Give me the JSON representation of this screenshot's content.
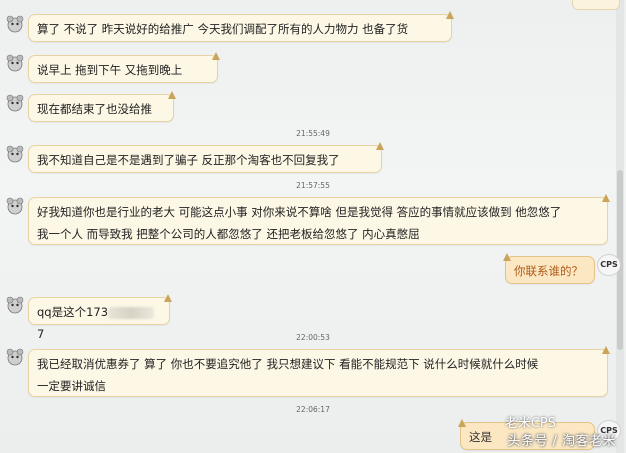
{
  "messages": [
    {
      "text": "算了 不说了  昨天说好的给推广  今天我们调配了所有的人力物力  也备了货"
    },
    {
      "text": "说早上  拖到下午    又拖到晚上"
    },
    {
      "text": "现在都结束了也没给推"
    },
    {
      "time": "21:55:49"
    },
    {
      "text": "我不知道自己是不是遇到了骗子  反正那个淘客也不回复我了"
    },
    {
      "time": "21:57:55"
    },
    {
      "line1": "好我知道你也是行业的老大   可能这点小事  对你来说不算啥   但是我觉得 答应的事情就应该做到    他忽悠了",
      "line2": "我一个人     而导致我     把整个公司的人都忽悠了   还把老板给忽悠了    内心真憋屈"
    },
    {
      "text": "你联系谁的？"
    },
    {
      "prefix": "qq是这个173",
      "suffix": "7"
    },
    {
      "time": "22:00:53"
    },
    {
      "line1": "我已经取消优惠券了      算了  你也不要追究他了     我只想建议下   看能不能规范下     说什么时候就什么时候",
      "line2": "一定要讲诚信"
    },
    {
      "time": "22:06:17"
    },
    {
      "text": "这是"
    }
  ],
  "cps_label": "CPS",
  "watermark": {
    "top": "老米CPS",
    "bottom": "头条号 / 淘客老米"
  }
}
